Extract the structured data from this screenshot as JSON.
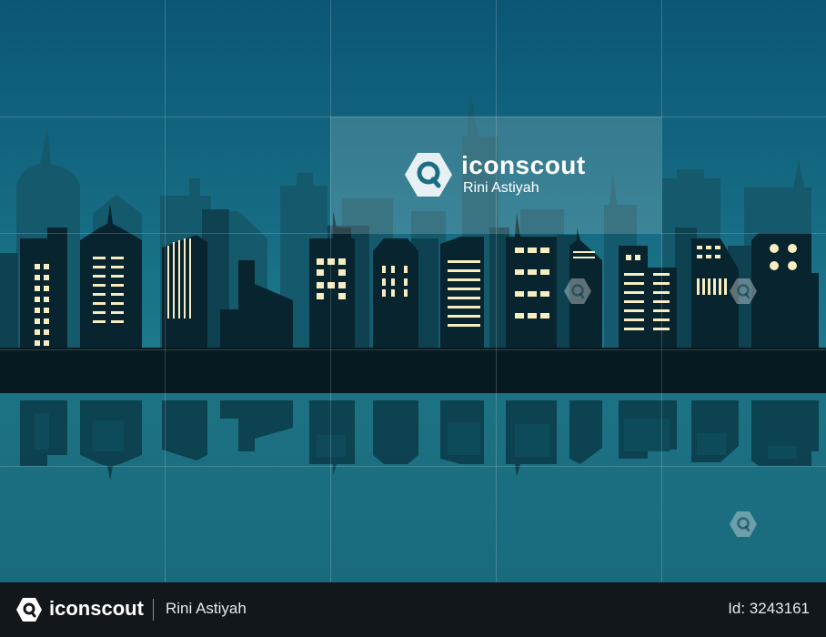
{
  "scene": {
    "description_tag": "city-skyline-illustration",
    "colors": {
      "sky_top": "#0c5a78",
      "sky_bottom": "#1d7a8c",
      "far_buildings": "#15596c",
      "mid_buildings": "#0f4354",
      "front_buildings": "#08242e",
      "ground": "#06181f",
      "window_light": "#f8edc0",
      "water": "#1c6f80",
      "reflection": "#0a3442"
    }
  },
  "watermark": {
    "brand": "iconscout",
    "author": "Rini Astiyah",
    "icon": "iconscout-logo-icon"
  },
  "footer": {
    "brand": "iconscout",
    "author": "Rini Astiyah",
    "id_text": "Id: 3243161",
    "icon": "iconscout-logo-icon"
  }
}
